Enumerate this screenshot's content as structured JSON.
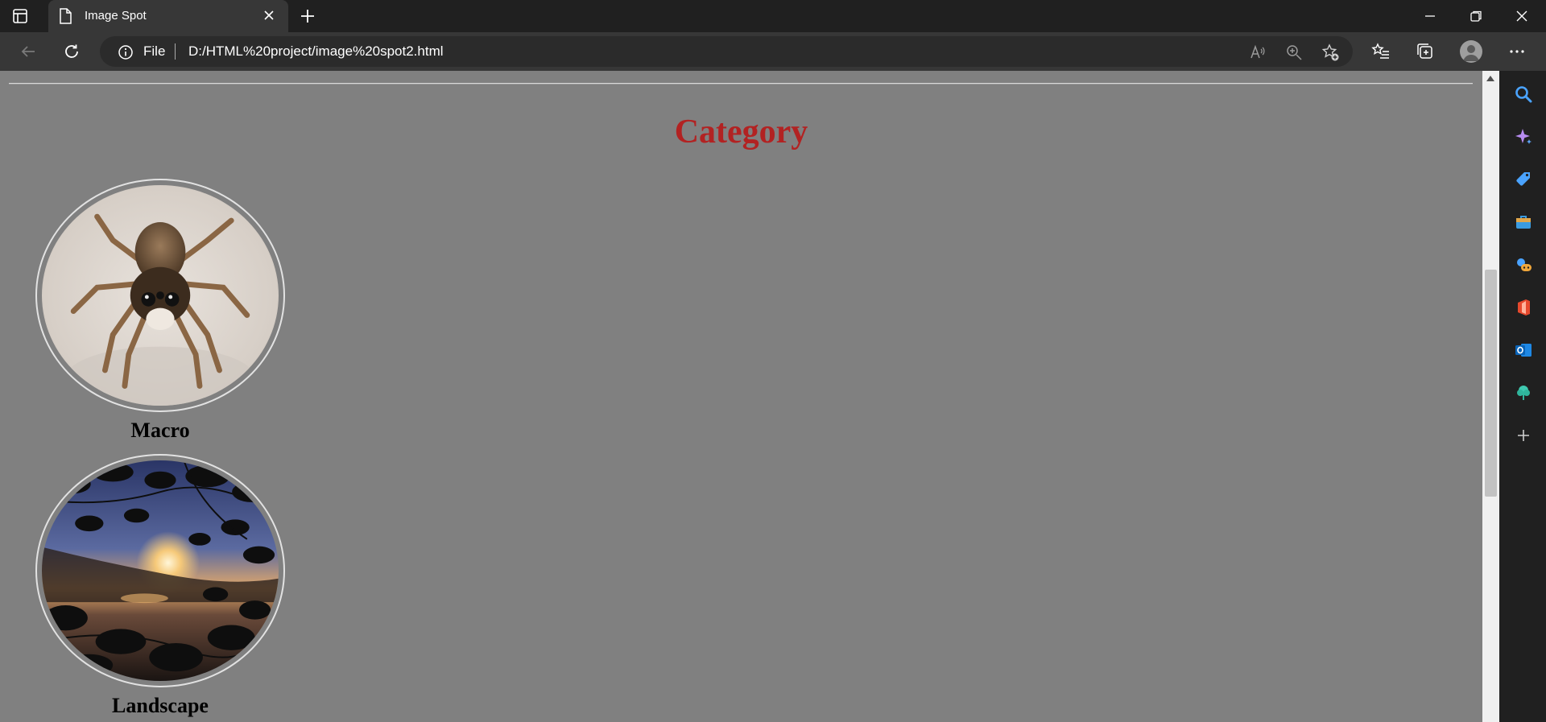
{
  "browser": {
    "tab_title": "Image Spot",
    "address": {
      "scheme_label": "File",
      "url": "D:/HTML%20project/image%20spot2.html"
    },
    "colors": {
      "frame": "#202020",
      "toolbar": "#373737",
      "page_background": "#808080",
      "heading": "#b22222"
    },
    "icons": {
      "tab_actions": "tab-actions-icon",
      "page": "page-icon",
      "close_tab": "close-icon",
      "new_tab": "plus-icon",
      "minimize": "minimize-icon",
      "restore": "restore-icon",
      "close_window": "close-icon",
      "back": "back-arrow-icon",
      "refresh": "refresh-icon",
      "site_info": "info-icon",
      "read_aloud": "read-aloud-icon",
      "zoom": "zoom-icon",
      "add_favorite": "star-plus-icon",
      "favorites": "favorites-list-icon",
      "collections": "collections-icon",
      "profile": "profile-avatar",
      "more": "more-icon"
    }
  },
  "page": {
    "heading": "Category",
    "categories": [
      {
        "label": "Macro",
        "image": "jumping spider close-up photo"
      },
      {
        "label": "Landscape",
        "image": "sunset over water through leaves photo"
      }
    ]
  },
  "sidebar": {
    "items": [
      {
        "icon": "search-icon"
      },
      {
        "icon": "copilot-sparkle-icon"
      },
      {
        "icon": "shopping-tag-icon"
      },
      {
        "icon": "tools-briefcase-icon"
      },
      {
        "icon": "games-icon"
      },
      {
        "icon": "office-icon"
      },
      {
        "icon": "outlook-icon"
      },
      {
        "icon": "drop-tree-icon"
      },
      {
        "icon": "add-icon"
      }
    ]
  }
}
